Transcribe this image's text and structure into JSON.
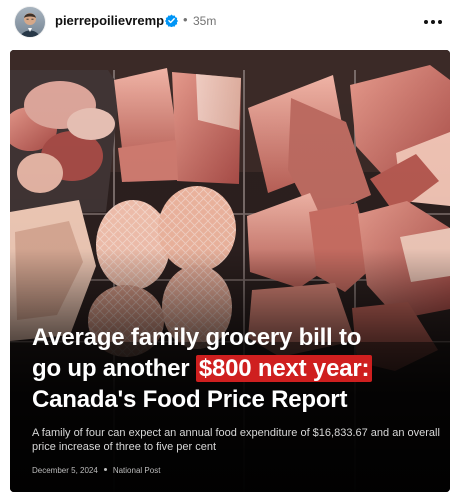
{
  "header": {
    "username": "pierrepoilievremp",
    "verified": true,
    "time_separator": "•",
    "time": "35m",
    "more_icon": "more-horizontal-icon"
  },
  "post": {
    "headline": {
      "line1": "Average family grocery bill to",
      "line2_prefix": "go up another ",
      "line2_highlight": "$800 next year:",
      "line3": "Canada's Food Price Report"
    },
    "summary": "A family of four can expect an annual food expenditure of $16,833.67 and an overall price increase of three to five per cent",
    "meta": {
      "date": "December 5, 2024",
      "source": "National Post"
    },
    "colors": {
      "highlight": "#cf1f1f",
      "text": "#ffffff",
      "verified": "#0095f6"
    }
  }
}
